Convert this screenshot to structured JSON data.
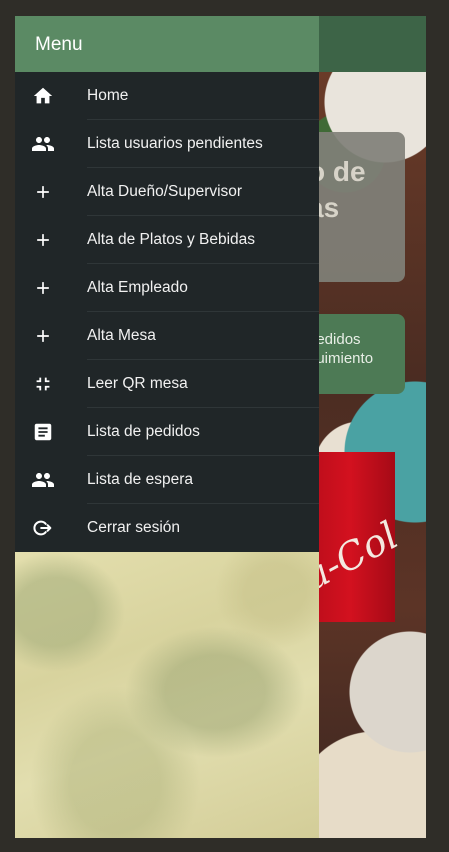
{
  "drawer": {
    "title": "Menu",
    "items": [
      {
        "label": "Home",
        "icon": "home-icon"
      },
      {
        "label": "Lista usuarios pendientes",
        "icon": "people-icon"
      },
      {
        "label": "Alta Dueño/Supervisor",
        "icon": "plus-icon"
      },
      {
        "label": "Alta de Platos y Bebidas",
        "icon": "plus-icon"
      },
      {
        "label": "Alta Empleado",
        "icon": "plus-icon"
      },
      {
        "label": "Alta Mesa",
        "icon": "plus-icon"
      },
      {
        "label": "Leer QR mesa",
        "icon": "scan-icon"
      },
      {
        "label": "Lista de pedidos",
        "icon": "document-icon"
      },
      {
        "label": "Lista de espera",
        "icon": "people-icon"
      },
      {
        "label": "Cerrar sesión",
        "icon": "logout-icon"
      }
    ]
  },
  "background": {
    "card_title_text": "o de\nas",
    "card_orders_text": "pedidos\nguimiento",
    "can_text": "a-Col"
  },
  "colors": {
    "drawer_header": "#5b8a64",
    "drawer_body": "#202628",
    "app_header": "#3d6447"
  }
}
